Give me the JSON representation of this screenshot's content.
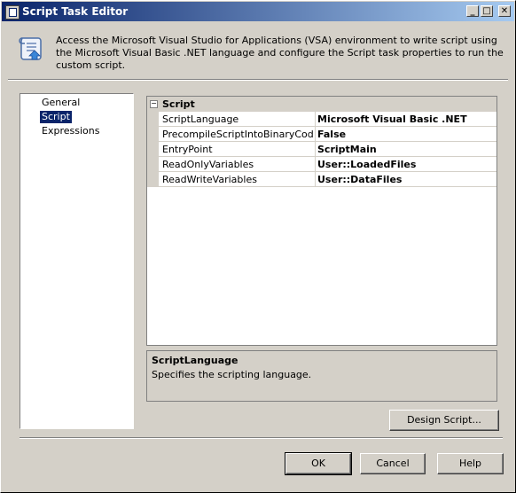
{
  "window": {
    "title": "Script Task Editor",
    "minimize": "_",
    "maximize": "□",
    "close": "✕"
  },
  "header": {
    "description": "Access the Microsoft Visual Studio for Applications (VSA) environment to write script using the Microsoft Visual Basic .NET language and configure the Script task properties to run the custom script."
  },
  "nav": {
    "items": [
      {
        "label": "General"
      },
      {
        "label": "Script"
      },
      {
        "label": "Expressions"
      }
    ]
  },
  "grid": {
    "category": "Script",
    "expander": "−",
    "properties": [
      {
        "name": "ScriptLanguage",
        "value": "Microsoft Visual Basic .NET"
      },
      {
        "name": "PrecompileScriptIntoBinaryCode",
        "value": "False"
      },
      {
        "name": "EntryPoint",
        "value": "ScriptMain"
      },
      {
        "name": "ReadOnlyVariables",
        "value": "User::LoadedFiles"
      },
      {
        "name": "ReadWriteVariables",
        "value": "User::DataFiles"
      }
    ]
  },
  "description": {
    "title": "ScriptLanguage",
    "text": "Specifies the scripting language."
  },
  "buttons": {
    "design_script": "Design Script...",
    "ok": "OK",
    "cancel": "Cancel",
    "help": "Help"
  }
}
